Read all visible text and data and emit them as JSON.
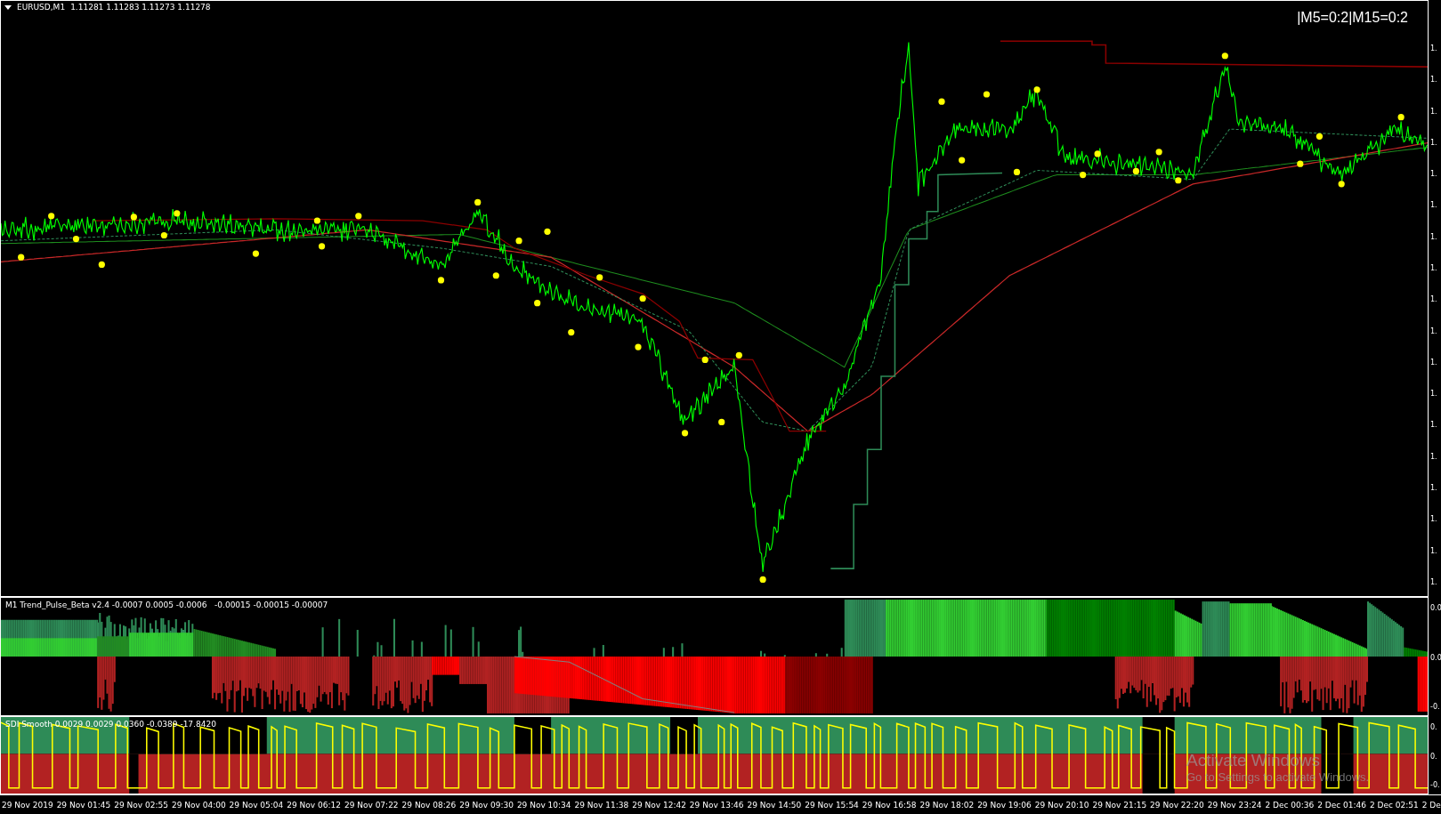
{
  "chart": {
    "title": "EURUSD,M1",
    "quotes": "1.11281 1.11283 1.11273 1.11278",
    "signal_text": "|M5=0:2|M15=0:2",
    "price_axis_labels": [
      "1.",
      "1.",
      "1.",
      "1.",
      "1.",
      "1.",
      "1.",
      "1.",
      "1.",
      "1.",
      "1.",
      "1.",
      "1.",
      "1.",
      "1.",
      "1.",
      "1.",
      "1."
    ]
  },
  "indicators": [
    {
      "label": "M1 Trend_Pulse_Beta v2.4 -0.0007 0.0005 -0.0006   -0.00015 -0.00015 -0.00007",
      "axis_labels": [
        "0.0",
        "0.0",
        "-0."
      ]
    },
    {
      "label": "SDI Smooth 0.0029 0.0029 0.0360 -0.0389 -17.8420",
      "axis_labels": [
        "0.",
        "0.",
        "-0."
      ]
    }
  ],
  "time_axis": [
    "29 Nov 2019",
    "29 Nov 01:45",
    "29 Nov 02:55",
    "29 Nov 04:00",
    "29 Nov 05:04",
    "29 Nov 06:12",
    "29 Nov 07:22",
    "29 Nov 08:26",
    "29 Nov 09:30",
    "29 Nov 10:34",
    "29 Nov 11:38",
    "29 Nov 12:42",
    "29 Nov 13:46",
    "29 Nov 14:50",
    "29 Nov 15:54",
    "29 Nov 16:58",
    "29 Nov 18:02",
    "29 Nov 19:06",
    "29 Nov 20:10",
    "29 Nov 21:15",
    "29 Nov 22:20",
    "29 Nov 23:24",
    "2 Dec 00:36",
    "2 Dec 01:46",
    "2 Dec 02:51",
    "2 De"
  ],
  "os_notice": {
    "title": "Activate Windows",
    "subtitle": "Go to Settings to activate Windows."
  }
}
